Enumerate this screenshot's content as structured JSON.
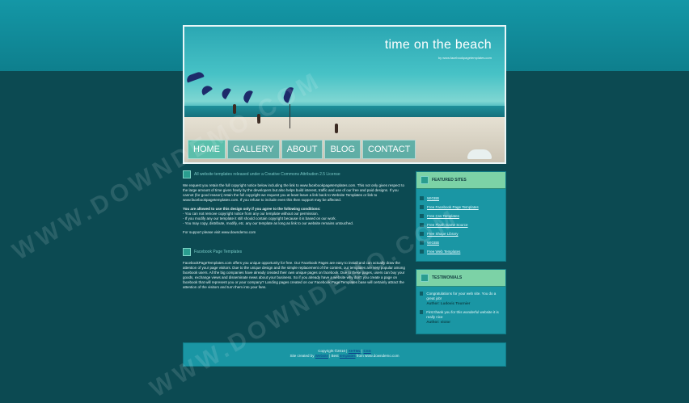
{
  "header": {
    "title": "time on the beach",
    "subtitle": "by www.facebookpagetemplates.com"
  },
  "nav": [
    "HOME",
    "GALLERY",
    "ABOUT",
    "BLOG",
    "CONTACT"
  ],
  "main": {
    "section1": {
      "heading": "All website templates released under a Creative Commons Attribution 2.5 License",
      "p1": "We request you retain the full copyright notice below including the link to www.facebookpagetemplates.com. This not only gives respect to the large amount of time given freely by the developers but also helps build interest, traffic and use of our free and paid designs. If you cannot (for good reason) retain the full copyright we request you at least leave a link back to Website Templates or link to www.facebookpagetemplates.com. If you refuse to include even this then support may be affected.",
      "p2_title": "You are allowed to use this design only if you agree to the following conditions:",
      "p2_items": [
        "- You can not remove copyright notice from any our template without our permission.",
        "- If you modify any our template it still should contain copyright because it is based on our work.",
        "- You may copy, distribute, modify, etc. any our template as long as link to our website remains untouched."
      ],
      "support": "For support please visit www.downdemo.com"
    },
    "section2": {
      "heading": "Facebook Page Templates",
      "p1": "FacebookPageTemplates.com offers you unique opportunity for free. Our Facebook Pages are easy to install and can actually draw the attention of your page visitors. Due to the unique design and the simple replacement of the content, our templates are very popular among facebook users. All the big companies have already created their own unique pages on facebook. Due to these pages, users can buy your goods, exchange views and disseminate news about your business. So if you already have a website why don't you create a page on facebook that will represent you or your company? Landing pages created on our Facebook Page Templates base will certainly attract the attention of the visitors and turn them into your fans."
    }
  },
  "sidebar": {
    "featured": {
      "title": "FEATURED SITES",
      "links": [
        "WIGBB",
        "Free Facebook Page Templates",
        "Free Css Templates",
        "Free Flash Game Source",
        "Free Shape Library",
        "WIGBB",
        "Free Web Templates"
      ]
    },
    "testimonials": {
      "title": "TESTIMONIALS",
      "items": [
        {
          "text": "Congratulations for your web site. You do a great job!",
          "author": "Author: Ludovic Tournier"
        },
        {
          "text": "First thank you for this wonderful website it is really nice",
          "author": "Author: victor"
        }
      ]
    }
  },
  "footer": {
    "copyright": "Copyright ©2010 |",
    "copyright_links": [
      "XHTML",
      "CSS"
    ],
    "credit_prefix": "Site created by",
    "credit_link1": "Website",
    "credit_mid": "| Best",
    "credit_link2": "templates",
    "credit_suffix": "from www.downdemo.com"
  },
  "watermark": "WWW.DOWNDEMO.COM",
  "colors": {
    "background": "#0c4a52",
    "top_band": "#1497a6",
    "panel": "#1a96a4",
    "panel_header": "#7cd2a6"
  }
}
